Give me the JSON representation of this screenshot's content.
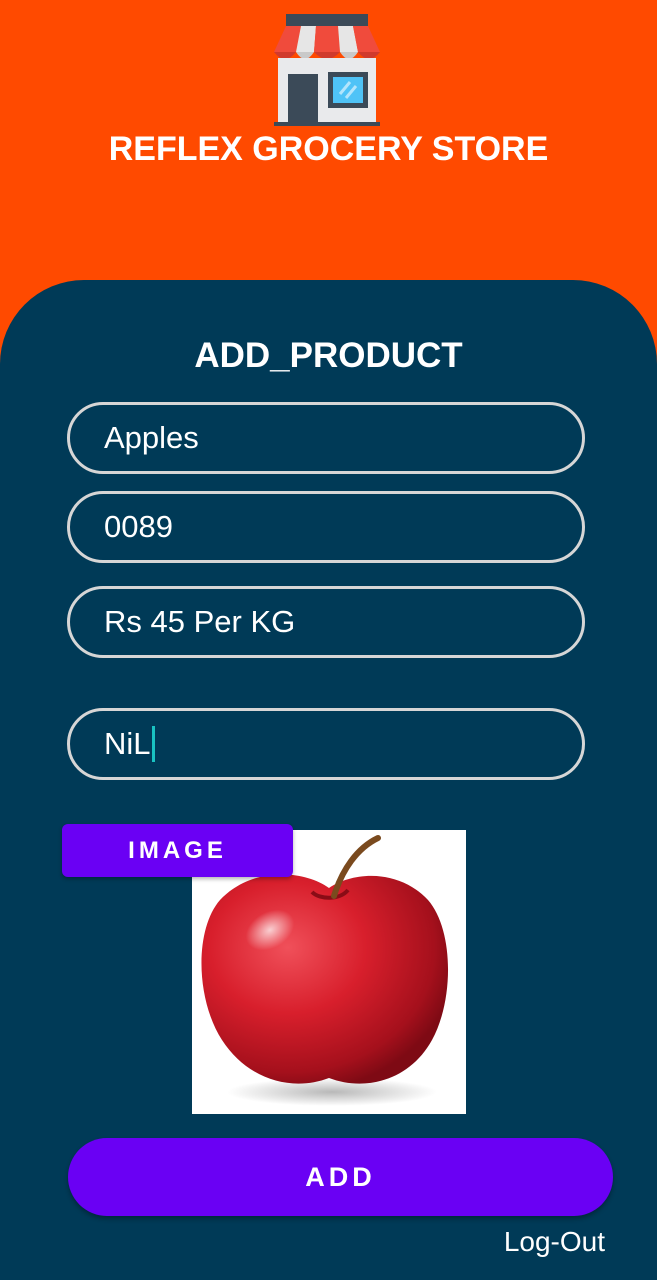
{
  "header": {
    "icon": "store-icon",
    "title": "REFLEX GROCERY STORE"
  },
  "form": {
    "title": "ADD_PRODUCT",
    "fields": {
      "product_name": "Apples",
      "product_code": "0089",
      "price": "Rs 45 Per KG",
      "discount": "NiL"
    },
    "image_button_label": "IMAGE",
    "image": "red-apple-photo",
    "submit_label": "ADD"
  },
  "footer": {
    "logout_label": "Log-Out"
  },
  "colors": {
    "header_background": "#FF4A00",
    "panel_background": "#003A57",
    "button_accent": "#6A00F4",
    "field_border": "#D6D6D6",
    "caret": "#19C2C2"
  }
}
